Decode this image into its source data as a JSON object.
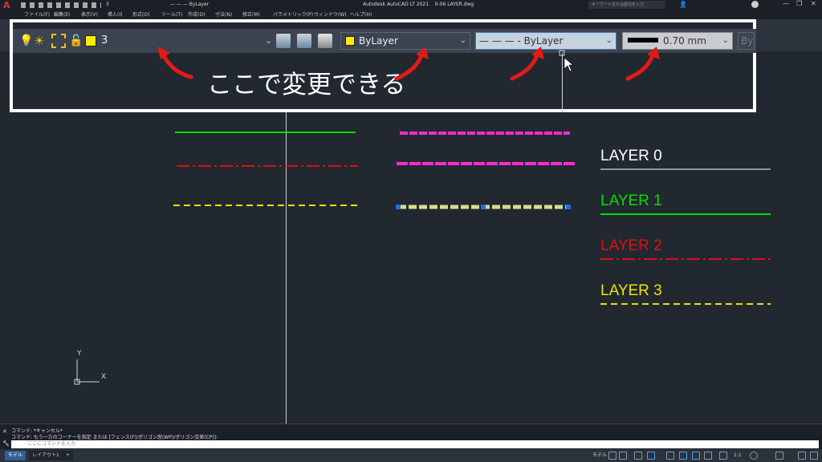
{
  "window": {
    "title": "Autodesk AutoCAD LT 2021    0-06 LAYER.dwg",
    "search_placeholder": "キーワードまたは語句を入力",
    "qat_layer": "3",
    "qat_linetype": "— — — ByLayer"
  },
  "menu": [
    "ファイル(F)",
    "編集(E)",
    "表示(V)",
    "挿入(I)",
    "形式(O)",
    "ツール(T)",
    "作成(D)",
    "寸法(N)",
    "修正(M)",
    "パラメトリック(P)",
    "ウィンドウ(W)",
    "ヘルプ(H)"
  ],
  "toolbar": {
    "layer_value": "3",
    "color_value": "ByLayer",
    "linetype_value": "— — — - ByLayer",
    "lineweight_value": "0.70 mm",
    "plotstyle_value": "By"
  },
  "caption": "ここで変更できる",
  "layers": [
    {
      "label": "LAYER 0",
      "color": "#ffffff"
    },
    {
      "label": "LAYER 1",
      "color": "#00e000"
    },
    {
      "label": "LAYER 2",
      "color": "#dd1111"
    },
    {
      "label": "LAYER 3",
      "color": "#f0e000"
    }
  ],
  "ucs": {
    "x": "X",
    "y": "Y"
  },
  "command": {
    "line1": "コマンド: *キャンセル*",
    "line2": "コマンド: もう一方のコーナーを指定 または [フェンス(F)/ポリゴン窓(WP)/ポリゴン交差(CP)]:",
    "placeholder": "ここにコマンドを入力"
  },
  "status": {
    "tabs": [
      "モデル",
      "レイアウト1",
      "+"
    ],
    "model_label": "モデル",
    "scale": "1:1"
  },
  "colors": {
    "accent": "#e53030",
    "arrow": "#e31a1a",
    "highlight": "#ff2ad4"
  }
}
